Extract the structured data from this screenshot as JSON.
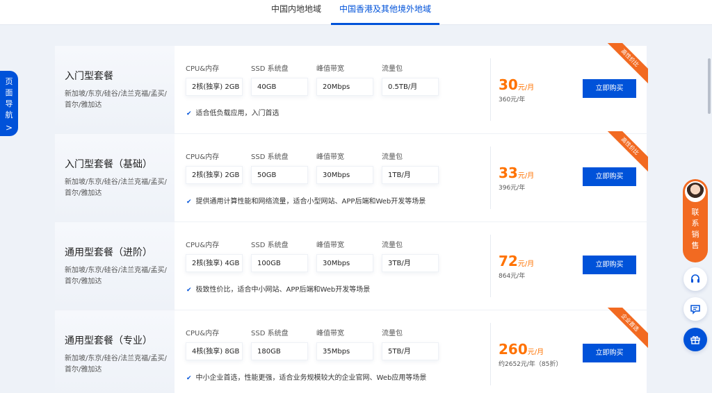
{
  "tabs": [
    {
      "label": "中国内地地域"
    },
    {
      "label": "中国香港及其他境外地域"
    }
  ],
  "page_nav": {
    "label": [
      "页",
      "面",
      "导",
      "航"
    ],
    "chevron": ">"
  },
  "spec_labels": {
    "cpu": "CPU&内存",
    "ssd": "SSD 系统盘",
    "bw": "峰值带宽",
    "traffic": "流量包"
  },
  "buy_label": "立即购买",
  "plans": [
    {
      "name": "入门型套餐",
      "regions": "新加坡/东京/硅谷/法兰克福/孟买/首尔/雅加达",
      "cpu": "2核(独享) 2GB",
      "ssd": "40GB",
      "bw": "20Mbps",
      "traffic": "0.5TB/月",
      "desc": "适合低负载应用，入门首选",
      "price": "30",
      "price_unit": "元/月",
      "yearly": "360元/年",
      "ribbon": "高性价比"
    },
    {
      "name": "入门型套餐（基础）",
      "regions": "新加坡/东京/硅谷/法兰克福/孟买/首尔/雅加达",
      "cpu": "2核(独享) 2GB",
      "ssd": "50GB",
      "bw": "30Mbps",
      "traffic": "1TB/月",
      "desc": "提供通用计算性能和网络流量，适合小型网站、APP后端和Web开发等场景",
      "price": "33",
      "price_unit": "元/月",
      "yearly": "396元/年",
      "ribbon": "高性价比"
    },
    {
      "name": "通用型套餐（进阶）",
      "regions": "新加坡/东京/硅谷/法兰克福/孟买/首尔/雅加达",
      "cpu": "2核(独享) 4GB",
      "ssd": "100GB",
      "bw": "30Mbps",
      "traffic": "3TB/月",
      "desc": "极致性价比，适合中小网站、APP后端和Web开发等场景",
      "price": "72",
      "price_unit": "元/月",
      "yearly": "864元/年",
      "ribbon": ""
    },
    {
      "name": "通用型套餐（专业）",
      "regions": "新加坡/东京/硅谷/法兰克福/孟买/首尔/雅加达",
      "cpu": "4核(独享) 8GB",
      "ssd": "180GB",
      "bw": "35Mbps",
      "traffic": "5TB/月",
      "desc": "中小企业首选，性能更强，适合业务规模较大的企业官网、Web应用等场景",
      "price": "260",
      "price_unit": "元/月",
      "yearly": "约2652元/年（85折）",
      "ribbon": "企业首选"
    }
  ],
  "sidebar": {
    "sales_label": [
      "联",
      "系",
      "销",
      "售"
    ],
    "icons": [
      "headset-icon",
      "chat-icon",
      "gift-icon"
    ]
  },
  "colors": {
    "accent": "#0052d9",
    "price": "#ff7200",
    "ribbon": "#f26a21"
  }
}
